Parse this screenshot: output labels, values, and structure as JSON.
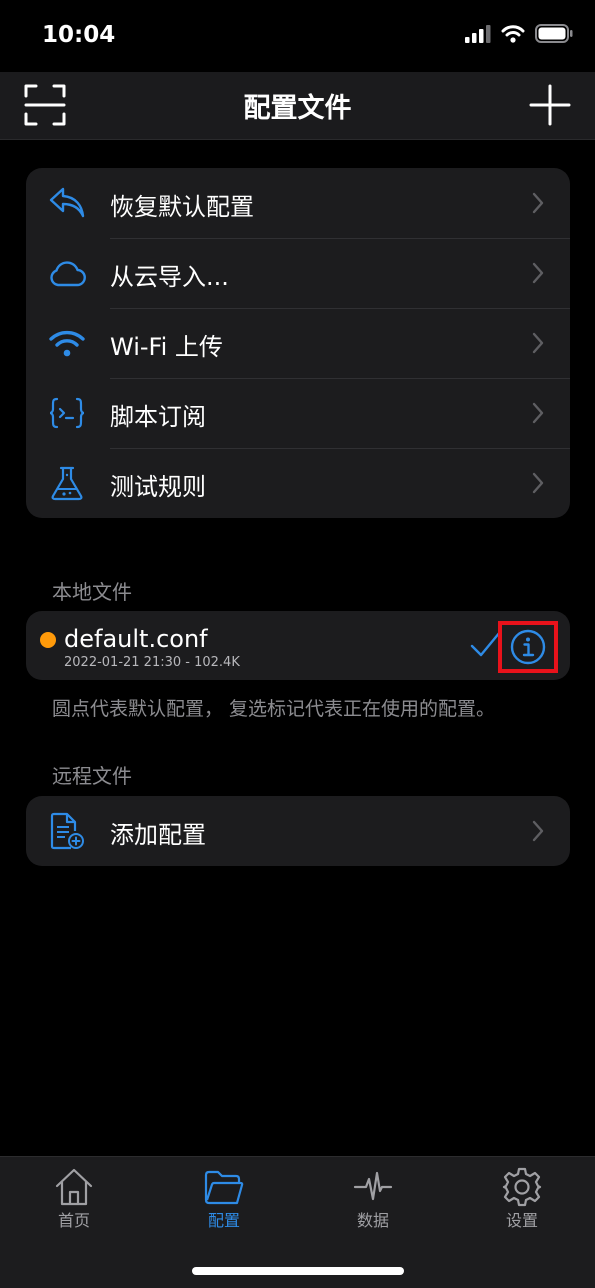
{
  "status": {
    "time": "10:04"
  },
  "nav": {
    "title": "配置文件"
  },
  "actions": [
    {
      "label": "恢复默认配置",
      "icon": "undo-arrow-icon"
    },
    {
      "label": "从云导入...",
      "icon": "cloud-icon"
    },
    {
      "label": "Wi-Fi 上传",
      "icon": "wifi-icon"
    },
    {
      "label": "脚本订阅",
      "icon": "script-braces-icon"
    },
    {
      "label": "测试规则",
      "icon": "flask-icon"
    }
  ],
  "local": {
    "section_title": "本地文件",
    "file": {
      "name": "default.conf",
      "meta": "2022-01-21 21:30 - 102.4K",
      "is_default": true,
      "in_use": true
    },
    "footnote": "圆点代表默认配置， 复选标记代表正在使用的配置。"
  },
  "remote": {
    "section_title": "远程文件",
    "add_label": "添加配置"
  },
  "tabs": [
    {
      "label": "首页",
      "icon": "home-icon",
      "active": false
    },
    {
      "label": "配置",
      "icon": "folder-icon",
      "active": true
    },
    {
      "label": "数据",
      "icon": "activity-icon",
      "active": false
    },
    {
      "label": "设置",
      "icon": "gear-icon",
      "active": false
    }
  ],
  "colors": {
    "accent": "#2e8be6",
    "default_dot": "#ff9a0a",
    "highlight": "#e8121b",
    "card": "#1c1c1e"
  }
}
